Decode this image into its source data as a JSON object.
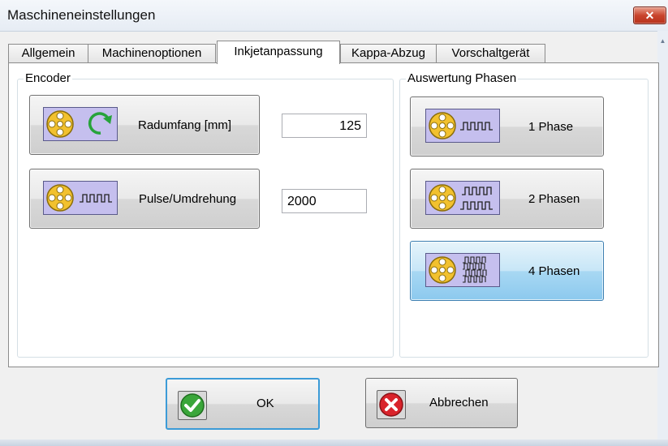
{
  "window": {
    "title": "Maschineneinstellungen",
    "close_label": "✕"
  },
  "tabs": [
    {
      "label": "Allgemein"
    },
    {
      "label": "Machinenoptionen"
    },
    {
      "label": "Inkjetanpassung",
      "active": true
    },
    {
      "label": "Kappa-Abzug"
    },
    {
      "label": "Vorschaltgerät"
    }
  ],
  "encoder": {
    "group_label": "Encoder",
    "radumfang_label": "Radumfang [mm]",
    "radumfang_value": "125",
    "pulse_label": "Pulse/Umdrehung",
    "pulse_value": "2000"
  },
  "phasen": {
    "group_label": "Auswertung Phasen",
    "options": [
      {
        "label": "1 Phase",
        "selected": false
      },
      {
        "label": "2 Phasen",
        "selected": false
      },
      {
        "label": "4 Phasen",
        "selected": true
      }
    ]
  },
  "footer": {
    "ok_label": "OK",
    "cancel_label": "Abbrechen"
  },
  "colors": {
    "icon_bg": "#c5bfee",
    "wheel": "#f2c12e",
    "selected_btn": "#a8d8f3",
    "ok_green": "#3aa63a",
    "cancel_red": "#d9232b"
  },
  "icons": {
    "wheel": "reel-wheel-icon",
    "rotate": "rotate-arrow-icon",
    "pulse": "pulse-wave-icon",
    "ok": "checkmark-icon",
    "cancel": "cross-icon"
  }
}
